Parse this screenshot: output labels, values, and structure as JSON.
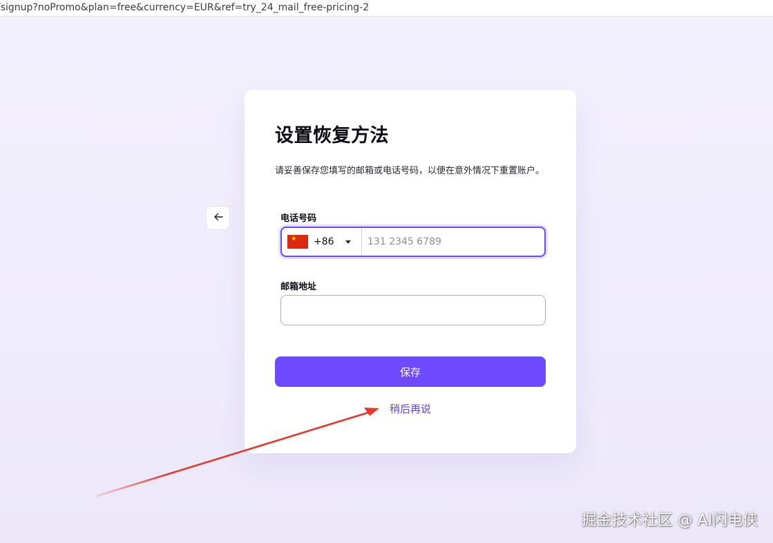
{
  "browser": {
    "url": "/signup?noPromo&plan=free&currency=EUR&ref=try_24_mail_free-pricing-2"
  },
  "back_button": {
    "icon": "arrow-left-icon",
    "glyph": "←"
  },
  "card": {
    "title": "设置恢复方法",
    "description": "请妥善保存您填写的邮箱或电话号码，以便在意外情况下重置账户。",
    "phone": {
      "label": "电话号码",
      "country_code": "+86",
      "flag": "china-flag-icon",
      "value": "",
      "placeholder": "131 2345 6789"
    },
    "email": {
      "label": "邮箱地址",
      "value": "",
      "placeholder": ""
    },
    "save_label": "保存",
    "later_label": "稍后再说"
  },
  "annotation": {
    "color": "#e8372a"
  },
  "watermark": "掘金技术社区 @ AI闪电侠",
  "colors": {
    "accent": "#6d4aff",
    "link": "#6243e0",
    "background": "#f1eefd"
  }
}
